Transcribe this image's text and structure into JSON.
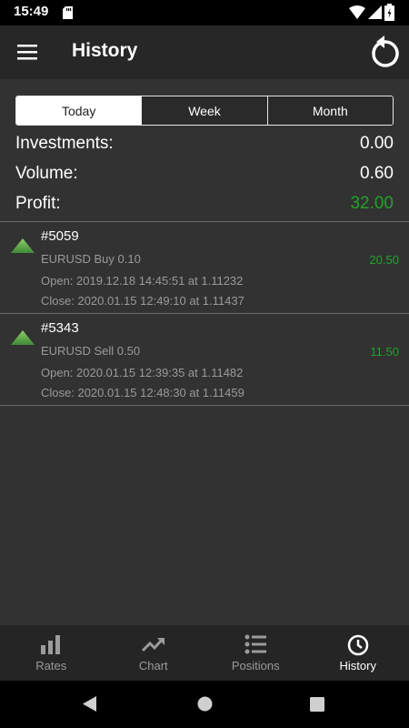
{
  "status_bar": {
    "time": "15:49"
  },
  "appbar": {
    "title": "History"
  },
  "tabs": [
    {
      "label": "Today",
      "active": true
    },
    {
      "label": "Week",
      "active": false
    },
    {
      "label": "Month",
      "active": false
    }
  ],
  "summary": {
    "investments": {
      "label": "Investments:",
      "value": "0.00"
    },
    "volume": {
      "label": "Volume:",
      "value": "0.60"
    },
    "profit": {
      "label": "Profit:",
      "value": "32.00"
    }
  },
  "trades": [
    {
      "id": "#5059",
      "instrument": "EURUSD  Buy  0.10",
      "profit": "20.50",
      "open": "Open: 2019.12.18 14:45:51  at  1.11232",
      "close": "Close: 2020.01.15 12:49:10  at  1.11437"
    },
    {
      "id": "#5343",
      "instrument": "EURUSD  Sell  0.50",
      "profit": "11.50",
      "open": "Open: 2020.01.15 12:39:35  at  1.11482",
      "close": "Close: 2020.01.15 12:48:30  at  1.11459"
    }
  ],
  "bottom_nav": [
    {
      "label": "Rates",
      "icon": "bar-chart-icon",
      "active": false
    },
    {
      "label": "Chart",
      "icon": "trending-up-icon",
      "active": false
    },
    {
      "label": "Positions",
      "icon": "list-icon",
      "active": false
    },
    {
      "label": "History",
      "icon": "clock-icon",
      "active": true
    }
  ],
  "colors": {
    "background": "#323232",
    "appbar": "#272727",
    "profit_green": "#21a32a",
    "muted_text": "#9a9a9a",
    "triangle_green": "#5aa54a"
  }
}
